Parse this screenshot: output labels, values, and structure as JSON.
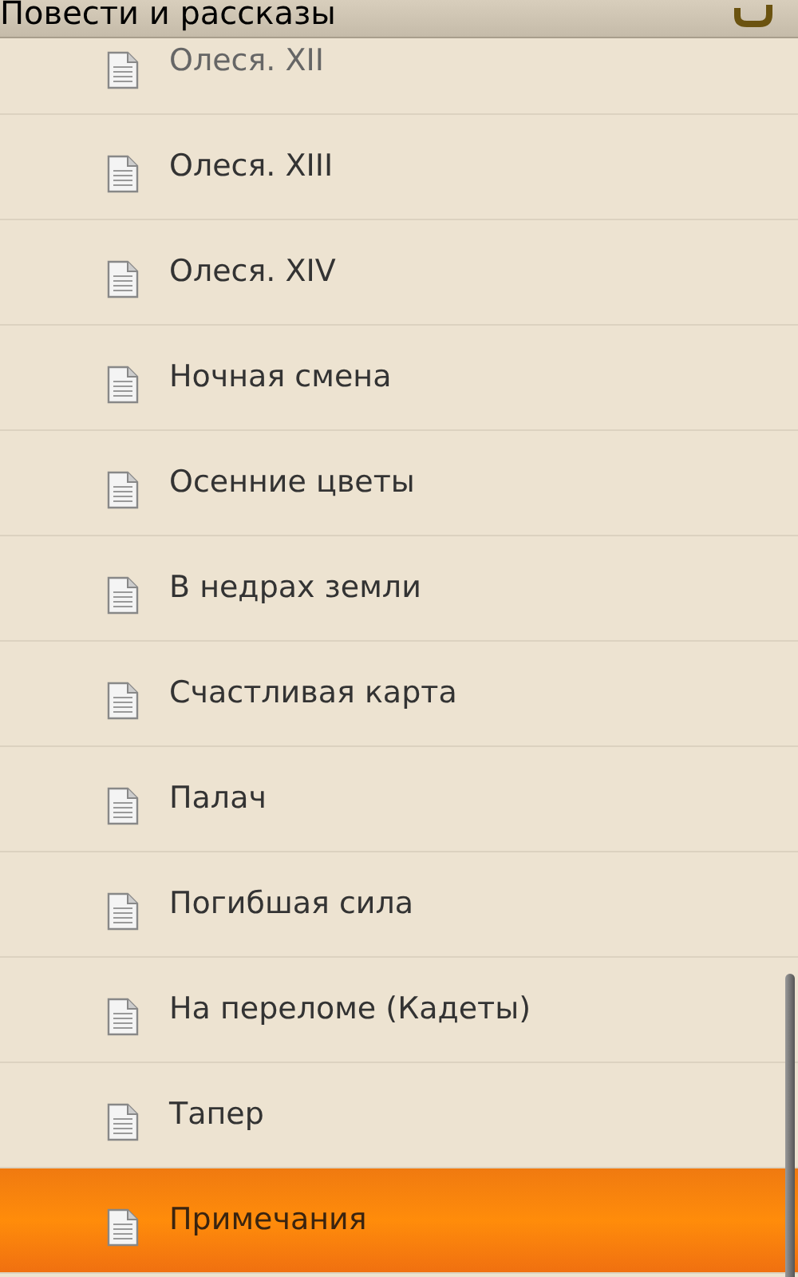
{
  "header": {
    "title": "Повести и рассказы"
  },
  "items": [
    {
      "label": "Олеся. XII",
      "selected": false
    },
    {
      "label": "Олеся. XIII",
      "selected": false
    },
    {
      "label": "Олеся. XIV",
      "selected": false
    },
    {
      "label": "Ночная смена",
      "selected": false
    },
    {
      "label": "Осенние цветы",
      "selected": false
    },
    {
      "label": "В недрах земли",
      "selected": false
    },
    {
      "label": "Счастливая карта",
      "selected": false
    },
    {
      "label": "Палач",
      "selected": false
    },
    {
      "label": "Погибшая сила",
      "selected": false
    },
    {
      "label": "На переломе (Кадеты)",
      "selected": false
    },
    {
      "label": "Тапер",
      "selected": false
    },
    {
      "label": "Примечания",
      "selected": true
    }
  ]
}
